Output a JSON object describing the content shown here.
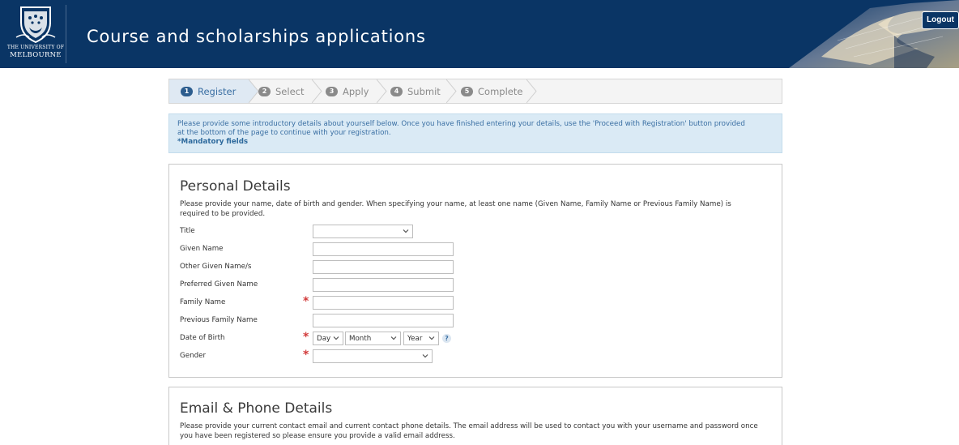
{
  "header": {
    "logo_line1": "THE UNIVERSITY OF",
    "logo_line2": "MELBOURNE",
    "title": "Course and scholarships applications",
    "logout_label": "Logout"
  },
  "steps": [
    {
      "num": "1",
      "label": "Register",
      "active": true
    },
    {
      "num": "2",
      "label": "Select",
      "active": false
    },
    {
      "num": "3",
      "label": "Apply",
      "active": false
    },
    {
      "num": "4",
      "label": "Submit",
      "active": false
    },
    {
      "num": "5",
      "label": "Complete",
      "active": false
    }
  ],
  "info": {
    "line1": "Please provide some introductory details about yourself below. Once you have finished entering your details, use the 'Proceed with Registration' button provided",
    "line2": "at the bottom of the page to continue with your registration.",
    "mandatory": "*Mandatory fields"
  },
  "personal": {
    "heading": "Personal Details",
    "desc1": "Please provide your name, date of birth and gender. When specifying your name, at least one name (Given Name, Family Name or Previous Family Name) is",
    "desc2": "required to be provided.",
    "required_marker": "*",
    "fields": {
      "title": {
        "label": "Title",
        "value": ""
      },
      "given_name": {
        "label": "Given Name",
        "value": ""
      },
      "other_given": {
        "label": "Other Given Name/s",
        "value": ""
      },
      "preferred_given": {
        "label": "Preferred Given Name",
        "value": ""
      },
      "family_name": {
        "label": "Family Name",
        "value": ""
      },
      "previous_family": {
        "label": "Previous Family Name",
        "value": ""
      },
      "dob": {
        "label": "Date of Birth",
        "day": "Day",
        "month": "Month",
        "year": "Year",
        "help": "?"
      },
      "gender": {
        "label": "Gender",
        "value": ""
      }
    }
  },
  "email_phone": {
    "heading": "Email & Phone Details",
    "desc1": "Please provide your current contact email and current contact phone details. The email address will be used to contact you with your username and password once",
    "desc2": "you have been registered so please ensure you provide a valid email address."
  },
  "colors": {
    "header_bg": "#0a3565",
    "step_active": "#3a6fa3",
    "info_bg": "#daeaf5",
    "required": "#d23b3b"
  },
  "icons": [
    "crest-icon",
    "chevron-down-icon",
    "help-icon",
    "phoenix-art-icon"
  ]
}
